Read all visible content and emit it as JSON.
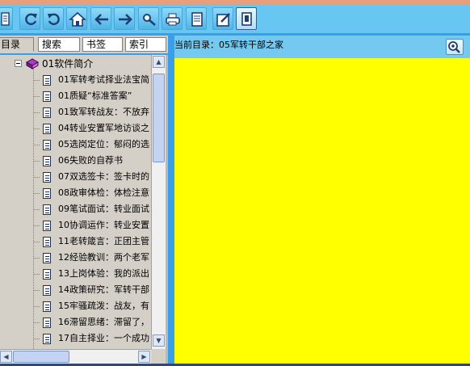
{
  "toolbar": {
    "buttons": [
      {
        "icon": "toc-icon"
      },
      {
        "icon": "refresh-icon"
      },
      {
        "icon": "reload-icon"
      },
      {
        "icon": "home-icon"
      },
      {
        "icon": "arrow-left-icon"
      },
      {
        "icon": "arrow-right-icon"
      },
      {
        "icon": "key-icon"
      },
      {
        "icon": "print-icon"
      },
      {
        "icon": "notes-icon"
      },
      {
        "icon": "edit-icon"
      },
      {
        "icon": "bookmark-page-icon"
      }
    ]
  },
  "left_panel": {
    "tabs": [
      "目录",
      "搜索",
      "书签",
      "索引"
    ],
    "active_tab": "目录",
    "tree": {
      "root": "01软件简介",
      "items": [
        "01军转考试择业法宝简",
        "01质疑“标准答案”",
        "01致军转战友：不放弃",
        "04转业安置军地访谈之",
        "05选岗定位：郁闷的选",
        "06失败的自荐书",
        "07双选签卡：签卡时的",
        "08政审体检：体检注意",
        "09笔试面试：转业面试",
        "10协调运作：转业安置",
        "11老转箴言：正团主管",
        "12经验教训：两个老军",
        "13上岗体验：我的派出",
        "14政策研究：军转干部",
        "15牢骚疏泼：战友，有",
        "16滞留思绪：滞留了，",
        "17自主择业：一个成功"
      ]
    }
  },
  "right_panel": {
    "current_dir_label": "当前目录：",
    "current_dir": "05军转干部之家",
    "content_bg": "#ffff00"
  },
  "colors": {
    "toolbar_bg": "#67c7f2",
    "frame_bg": "#3a9ee8",
    "panel_bg": "#d4d0c8"
  }
}
